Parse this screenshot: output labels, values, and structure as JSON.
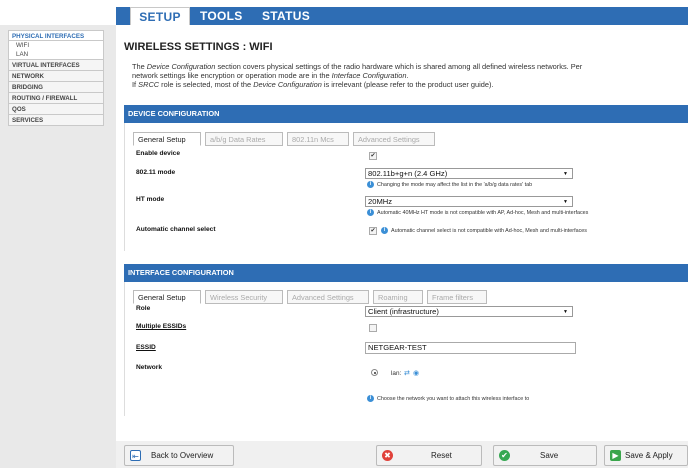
{
  "top_nav": {
    "setup": "SETUP",
    "tools": "TOOLS",
    "status": "STATUS"
  },
  "sidebar": {
    "items": [
      {
        "label": "PHYSICAL INTERFACES",
        "active": true,
        "children": [
          "WIFI",
          "LAN"
        ]
      },
      {
        "label": "VIRTUAL INTERFACES"
      },
      {
        "label": "NETWORK"
      },
      {
        "label": "BRIDGING"
      },
      {
        "label": "ROUTING / FIREWALL"
      },
      {
        "label": "QOS"
      },
      {
        "label": "SERVICES"
      }
    ]
  },
  "page": {
    "title": "WIRELESS SETTINGS : WIFI",
    "intro_1a": "The ",
    "intro_1b": "Device Configuration",
    "intro_1c": " section covers physical settings of the radio hardware which is shared among all defined wireless networks. Per",
    "intro_2a": "network settings like encryption or operation mode are in the ",
    "intro_2b": "Interface Configuration",
    "intro_2c": ".",
    "intro_3a": "If ",
    "intro_3b": "SRCC",
    "intro_3c": " role is selected, most of the ",
    "intro_3d": "Device Configuration",
    "intro_3e": " is irrelevant (please refer to the product user guide)."
  },
  "device_config": {
    "header": "DEVICE CONFIGURATION",
    "tabs": [
      "General Setup",
      "a/b/g Data Rates",
      "802.11n Mcs",
      "Advanced Settings"
    ],
    "enable_device_label": "Enable device",
    "enable_device_checked": "✔",
    "mode_label": "802.11 mode",
    "mode_value": "802.11b+g+n (2.4 GHz)",
    "mode_hint": "Changing the mode may affect the list in the 'a/b/g data rates' tab",
    "ht_label": "HT mode",
    "ht_value": "20MHz",
    "ht_hint": "Automatic 40MHz HT mode is not compatible with AP, Ad-hoc, Mesh and multi-interfaces",
    "auto_channel_label": "Automatic channel select",
    "auto_channel_checked": "✔",
    "auto_channel_hint": "Automatic channel select is not compatible with Ad-hoc, Mesh and multi-interfaces"
  },
  "interface_config": {
    "header": "INTERFACE CONFIGURATION",
    "tabs": [
      "General Setup",
      "Wireless Security",
      "Advanced Settings",
      "Roaming",
      "Frame filters"
    ],
    "role_label": "Role",
    "role_value": "Client (infrastructure)",
    "multi_essid_label": "Multiple ESSIDs",
    "essid_label": "ESSID",
    "essid_value": "NETGEAR-TEST",
    "network_label": "Network",
    "network_option": "lan:",
    "network_hint": "Choose the network you want to attach this wireless interface to"
  },
  "footer": {
    "back": "Back to Overview",
    "reset": "Reset",
    "save": "Save",
    "save_apply": "Save & Apply"
  },
  "colors": {
    "accent": "#2e6db4",
    "info": "#3b8fd6",
    "reset": "#e0413a",
    "save": "#36a852",
    "apply": "#3aa64c"
  },
  "icons": {
    "info": "info-icon",
    "back": "back-arrow-icon",
    "reset": "reset-icon",
    "save": "check-icon",
    "apply": "apply-icon"
  }
}
